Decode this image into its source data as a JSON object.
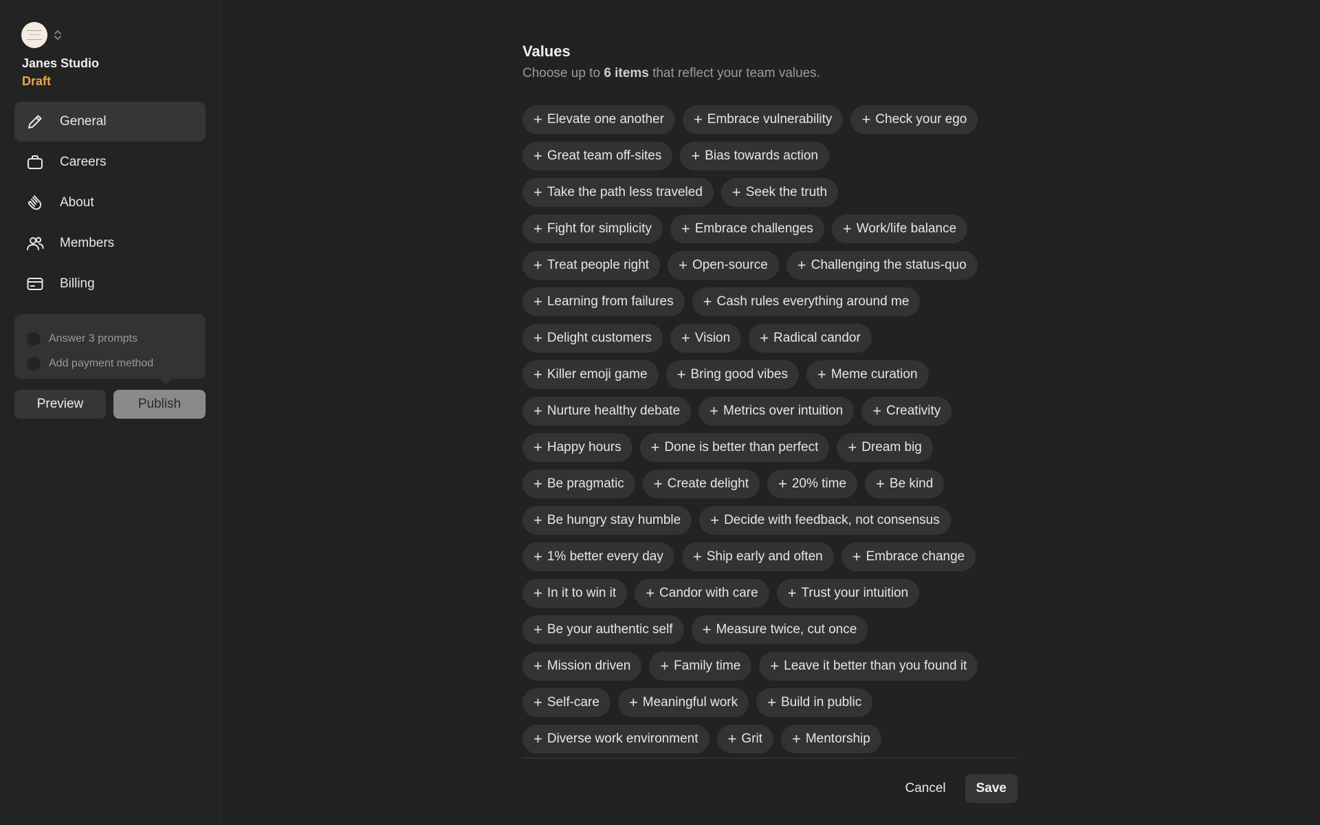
{
  "workspace": {
    "name": "Janes Studio",
    "status": "Draft"
  },
  "nav": {
    "items": [
      {
        "label": "General",
        "icon": "pencil-icon",
        "active": true
      },
      {
        "label": "Careers",
        "icon": "briefcase-icon"
      },
      {
        "label": "About",
        "icon": "wave-hand-icon"
      },
      {
        "label": "Members",
        "icon": "users-icon"
      },
      {
        "label": "Billing",
        "icon": "credit-card-icon"
      }
    ]
  },
  "checklist": {
    "items": [
      {
        "label": "Answer 3 prompts"
      },
      {
        "label": "Add payment method"
      }
    ]
  },
  "actions": {
    "preview_label": "Preview",
    "publish_label": "Publish"
  },
  "values": {
    "title": "Values",
    "subtitle_prefix": "Choose up to ",
    "subtitle_bold": "6 items",
    "subtitle_suffix": " that reflect your team values.",
    "rows": [
      [
        "Elevate one another",
        "Embrace vulnerability",
        "Check your ego"
      ],
      [
        "Great team off-sites",
        "Bias towards action"
      ],
      [
        "Take the path less traveled",
        "Seek the truth"
      ],
      [
        "Fight for simplicity",
        "Embrace challenges",
        "Work/life balance"
      ],
      [
        "Treat people right",
        "Open-source",
        "Challenging the status-quo"
      ],
      [
        "Learning from failures",
        "Cash rules everything around me"
      ],
      [
        "Delight customers",
        "Vision",
        "Radical candor"
      ],
      [
        "Killer emoji game",
        "Bring good vibes",
        "Meme curation"
      ],
      [
        "Nurture healthy debate",
        "Metrics over intuition",
        "Creativity"
      ],
      [
        "Happy hours",
        "Done is better than perfect",
        "Dream big"
      ],
      [
        "Be pragmatic",
        "Create delight",
        "20% time",
        "Be kind"
      ],
      [
        "Be hungry stay humble",
        "Decide with feedback, not consensus"
      ],
      [
        "1% better every day",
        "Ship early and often",
        "Embrace change"
      ],
      [
        "In it to win it",
        "Candor with care",
        "Trust your intuition"
      ],
      [
        "Be your authentic self",
        "Measure twice, cut once"
      ],
      [
        "Mission driven",
        "Family time",
        "Leave it better than you found it"
      ],
      [
        "Self-care",
        "Meaningful work",
        "Build in public"
      ],
      [
        "Diverse work environment",
        "Grit",
        "Mentorship"
      ]
    ],
    "add_icon": "+"
  },
  "footer": {
    "cancel_label": "Cancel",
    "save_label": "Save"
  }
}
